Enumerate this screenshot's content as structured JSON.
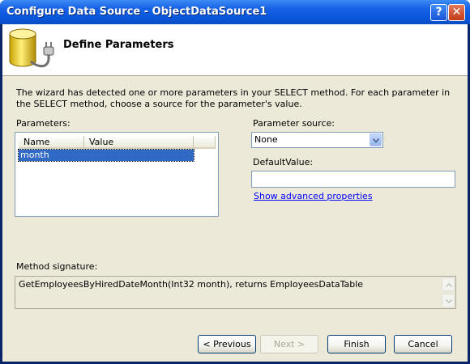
{
  "window": {
    "title": "Configure Data Source - ObjectDataSource1",
    "help_glyph": "?",
    "close_glyph": "✕"
  },
  "header": {
    "title": "Define Parameters",
    "icon": "database-plug-icon"
  },
  "description": "The wizard has detected one or more parameters in your SELECT method. For each parameter in the SELECT method, choose a source for the parameter's value.",
  "parameters": {
    "label": "Parameters:",
    "columns": [
      "Name",
      "Value"
    ],
    "rows": [
      {
        "name": "month",
        "value": ""
      }
    ]
  },
  "parameter_source": {
    "label": "Parameter source:",
    "selected": "None"
  },
  "default_value": {
    "label": "DefaultValue:",
    "value": ""
  },
  "advanced_link": "Show advanced properties",
  "method_signature": {
    "label": "Method signature:",
    "text": "GetEmployeesByHiredDateMonth(Int32 month), returns EmployeesDataTable"
  },
  "buttons": {
    "previous": "< Previous",
    "next": "Next >",
    "finish": "Finish",
    "cancel": "Cancel"
  },
  "colors": {
    "titlebar": "#0a58dc",
    "dialog_bg": "#ece9d8",
    "selection": "#316ac5",
    "link": "#0000ff"
  }
}
